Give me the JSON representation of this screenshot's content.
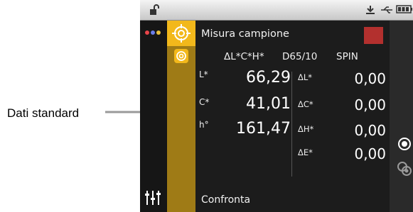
{
  "callout": {
    "label": "Dati standard"
  },
  "panel": {
    "title": "Misura campione",
    "header": {
      "mode": "ΔL*C*H*",
      "illuminant": "D65/10",
      "spec": "SPIN"
    },
    "color_swatch": "#B3302E",
    "rows": [
      {
        "label": "L*",
        "value": "66,29",
        "delta_label": "ΔL*",
        "delta_value": "0,00"
      },
      {
        "label": "C*",
        "value": "41,01",
        "delta_label": "ΔC*",
        "delta_value": "0,00"
      },
      {
        "label": "h°",
        "value": "161,47",
        "delta_label": "ΔH*",
        "delta_value": "0,00"
      },
      {
        "label": "",
        "value": "",
        "delta_label": "ΔE*",
        "delta_value": "0,00"
      }
    ],
    "footer": "Confronta"
  },
  "icons": {
    "status": [
      "lock-open-icon",
      "download-icon",
      "usb-icon",
      "battery-icon"
    ],
    "left": [
      "dots-menu-icon",
      "sliders-icon"
    ],
    "tabs": [
      "target-icon",
      "target-small-icon"
    ],
    "right": [
      "measure-icon",
      "compare-icon"
    ]
  },
  "colors": {
    "accent": "#F2B81B",
    "tab_strip": "#9F7B16",
    "background": "#1C1C1C"
  }
}
